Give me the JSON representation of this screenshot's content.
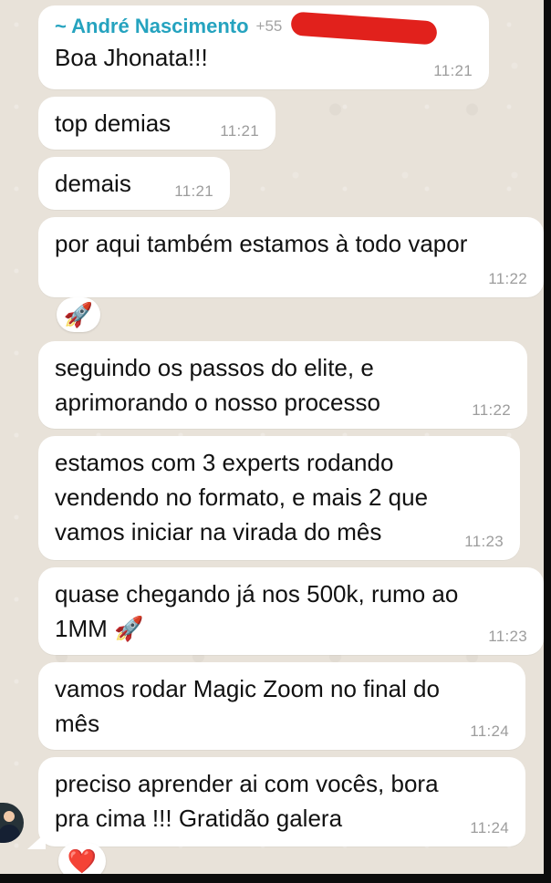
{
  "sender": {
    "name": "~ André Nascimento",
    "phone_prefix": "+55"
  },
  "messages": [
    {
      "text": "Boa Jhonata!!!",
      "time": "11:21"
    },
    {
      "text": "top demias",
      "time": "11:21"
    },
    {
      "text": "demais",
      "time": "11:21"
    },
    {
      "text": "por aqui também estamos à todo vapor",
      "time": "11:22",
      "reaction": "🚀"
    },
    {
      "line1": "seguindo os passos do elite, e",
      "line2": "aprimorando o nosso processo",
      "time": "11:22"
    },
    {
      "line1": "estamos com 3 experts rodando",
      "line2": "vendendo no formato, e mais 2 que",
      "line3": "vamos iniciar na virada do mês",
      "time": "11:23"
    },
    {
      "line1": "quase chegando já nos 500k, rumo ao",
      "line2": "1MM 🚀",
      "time": "11:23"
    },
    {
      "line1": "vamos rodar Magic Zoom no final do",
      "line2": "mês",
      "time": "11:24"
    },
    {
      "line1": "preciso aprender ai com vocês, bora",
      "line2": "pra cima !!! Gratidão galera",
      "time": "11:24",
      "reaction": "❤️"
    }
  ]
}
